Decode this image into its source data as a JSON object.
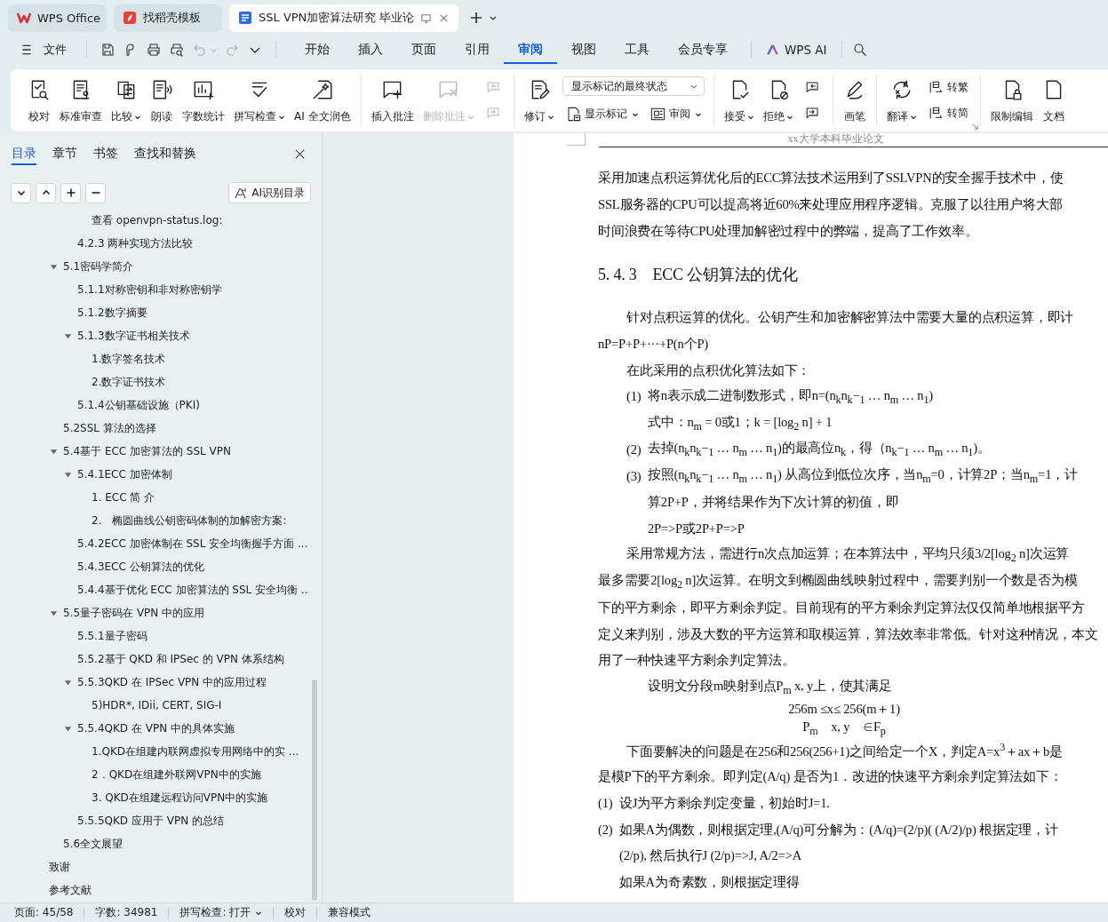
{
  "doc_tabs": [
    {
      "label": "WPS Office",
      "selected": false
    },
    {
      "label": "找稻壳模板",
      "selected": false
    },
    {
      "label": "SSL VPN加密算法研究 毕业论",
      "selected": true
    }
  ],
  "menu": {
    "file": "文件",
    "tabs": [
      {
        "label": "开始",
        "selected": false
      },
      {
        "label": "插入",
        "selected": false
      },
      {
        "label": "页面",
        "selected": false
      },
      {
        "label": "引用",
        "selected": false
      },
      {
        "label": "审阅",
        "selected": true
      },
      {
        "label": "视图",
        "selected": false
      },
      {
        "label": "工具",
        "selected": false
      },
      {
        "label": "会员专享",
        "selected": false
      }
    ],
    "ai": "WPS AI"
  },
  "ribbon": {
    "groups": [
      {
        "items": [
          {
            "kind": "large",
            "label": "校对",
            "menu": false,
            "disabled": false
          },
          {
            "kind": "large",
            "label": "标准审查",
            "menu": false,
            "disabled": false
          },
          {
            "kind": "large",
            "label": "比较",
            "menu": true,
            "disabled": false
          },
          {
            "kind": "large",
            "label": "朗读",
            "menu": false,
            "disabled": false
          },
          {
            "kind": "large",
            "label": "字数统计",
            "menu": false,
            "disabled": false
          },
          {
            "kind": "large",
            "label": "拼写检查",
            "menu": true,
            "disabled": false
          },
          {
            "kind": "large",
            "label": "AI 全文润色",
            "menu": false,
            "disabled": false
          }
        ]
      },
      {
        "items": [
          {
            "kind": "large",
            "label": "插入批注",
            "menu": false,
            "disabled": false
          },
          {
            "kind": "large",
            "label": "删除批注",
            "menu": true,
            "disabled": true
          },
          {
            "kind": "stack",
            "items": [
              {
                "menu": false,
                "disabled": true
              },
              {
                "menu": false,
                "disabled": true
              }
            ]
          }
        ]
      },
      {
        "items": [
          {
            "kind": "large",
            "label": "修订",
            "menu": true,
            "disabled": false
          },
          {
            "kind": "select",
            "value": "显示标记的最终状态",
            "items": [
              {
                "label": "显示标记",
                "menu": true,
                "disabled": false
              },
              {
                "label": "审阅",
                "menu": true,
                "disabled": false
              }
            ]
          }
        ]
      },
      {
        "items": [
          {
            "kind": "large",
            "label": "接受",
            "menu": true,
            "disabled": false
          },
          {
            "kind": "large",
            "label": "拒绝",
            "menu": true,
            "disabled": false
          },
          {
            "kind": "stack",
            "items": [
              {
                "menu": false,
                "disabled": false
              },
              {
                "menu": false,
                "disabled": false
              }
            ]
          }
        ]
      },
      {
        "items": [
          {
            "kind": "large",
            "label": "画笔",
            "menu": false,
            "disabled": false
          }
        ]
      },
      {
        "launcher": true,
        "items": [
          {
            "kind": "large",
            "label": "翻译",
            "menu": true,
            "disabled": false
          },
          {
            "kind": "stack",
            "items": [
              {
                "label": "转繁",
                "menu": false,
                "disabled": false
              },
              {
                "label": "转简",
                "menu": false,
                "disabled": false
              }
            ]
          }
        ]
      },
      {
        "items": [
          {
            "kind": "large",
            "label": "限制编辑",
            "menu": false,
            "disabled": false
          },
          {
            "kind": "large",
            "label": "文档",
            "menu": false,
            "disabled": false
          }
        ]
      }
    ]
  },
  "sidebar": {
    "tabs": [
      {
        "label": "目录",
        "selected": true
      },
      {
        "label": "章节",
        "selected": false
      },
      {
        "label": "书签",
        "selected": false
      },
      {
        "label": "查找和替换",
        "selected": false
      }
    ],
    "ai_button": "AI识别目录",
    "items": [
      {
        "children": [
          {
            "children": [
              {
                "children": [
                  {
                    "label": "查看 openvpn-status.log:"
                  }
                ]
              },
              {
                "label": "4.2.3 两种实现方法比较"
              }
            ]
          }
        ]
      },
      {
        "children": [
          {
            "label": "5.1密码学简介",
            "expanded": true,
            "children": [
              {
                "label": "5.1.1对称密钥和非对称密钥学"
              },
              {
                "label": "5.1.2数字摘要"
              },
              {
                "label": "5.1.3数字证书相关技术",
                "expanded": true,
                "children": [
                  {
                    "label": "1.数字签名技术"
                  },
                  {
                    "label": "2.数字证书技术"
                  }
                ]
              },
              {
                "label": "5.1.4公钥基础设施（PKI)"
              }
            ]
          },
          {
            "label": "5.2SSL 算法的选择"
          },
          {
            "label": "5.4基于 ECC 加密算法的 SSL VPN",
            "expanded": true,
            "children": [
              {
                "label": "5.4.1ECC 加密体制",
                "expanded": true,
                "children": [
                  {
                    "label": "1. ECC 简 介"
                  },
                  {
                    "label": "2.　椭圆曲线公钥密码体制的加解密方案:"
                  }
                ]
              },
              {
                "label": "5.4.2ECC 加密体制在 SSL 安全均衡握手方面 ..."
              },
              {
                "label": "5.4.3ECC 公钥算法的优化"
              },
              {
                "label": "5.4.4基于优化 ECC 加密算法的 SSL 安全均衡 ..."
              }
            ]
          },
          {
            "label": "5.5量子密码在 VPN 中的应用",
            "expanded": true,
            "children": [
              {
                "label": "5.5.1量子密码"
              },
              {
                "label": "5.5.2基于 QKD 和 IPSec 的 VPN 体系结构"
              },
              {
                "label": "5.5.3QKD 在 IPSec VPN 中的应用过程",
                "expanded": true,
                "children": [
                  {
                    "label": "5)HDR*, IDii, CERT, SIG-I"
                  }
                ]
              },
              {
                "label": "5.5.4QKD 在 VPN 中的具体实施",
                "expanded": true,
                "children": [
                  {
                    "label": "1.QKD在组建内联网虚拟专用网络中的实 ..."
                  },
                  {
                    "label": "2．QKD在组建外联网VPN中的实施"
                  },
                  {
                    "label": "3. QKD在组建远程访问VPN中的实施"
                  }
                ]
              },
              {
                "label": "5.5.5QKD 应用于 VPN 的总结"
              }
            ]
          },
          {
            "label": "5.6全文展望"
          }
        ]
      },
      {
        "label": "致谢"
      },
      {
        "label": "参考文献"
      }
    ]
  },
  "document": {
    "header": "xx大学本科毕业论文",
    "blocks": [
      {
        "kind": "line",
        "text": "采用加速点积运算优化后的ECC算法技术运用到了SSLVPN的安全握手技术中，使"
      },
      {
        "kind": "line",
        "text": "SSL服务器的CPU可以提高将近60%来处理应用程序逻辑。克服了以往用户将大部"
      },
      {
        "kind": "line",
        "text": "时间浪费在等待CPU处理加解密过程中的弊端，提高了工作效率。"
      },
      {
        "kind": "heading",
        "text": "5. 4. 3　ECC 公钥算法的优化"
      },
      {
        "kind": "para",
        "text": "针对点积运算的优化。公钥产生和加密解密算法中需要大量的点积运算，即计"
      },
      {
        "kind": "line",
        "text": "nP=P+P+···+P(n个P)"
      },
      {
        "kind": "para",
        "text": "在此采用的点积优化算法如下："
      },
      {
        "kind": "item",
        "marker": "(1)",
        "text": "将n表示成二进制数形式，即n=(n$_{k}$n$_{k}$−$_{1}$ … n$_{m}$ … n$_{1}$)"
      },
      {
        "kind": "cont",
        "text": "式中：n$_{m}$ = 0或1；k = [log$_{2}$ n] + 1"
      },
      {
        "kind": "item",
        "marker": "(2)",
        "text": "去掉(n$_{k}$n$_{k}$−$_{1}$ … n$_{m}$ … n$_{1}$)的最高位n$_{k}$，得（n$_{k}$−$_{1}$ … n$_{m}$ … n$_{1}$)。"
      },
      {
        "kind": "item",
        "marker": "(3)",
        "text": "按照(n$_{k}$n$_{k}$−$_{1}$ … n$_{m}$ … n$_{1}$) 从高位到低位次序，当n$_{m}$=0，计算2P；当n$_{m}$=1，计"
      },
      {
        "kind": "cont",
        "text": "算2P+P，并将结果作为下次计算的初值，即"
      },
      {
        "kind": "cont",
        "text": "2P=>P或2P+P=>P"
      },
      {
        "kind": "para",
        "text": "采用常规方法，需进行n次点加运算；在本算法中，平均只须3/2[log$_{2}$ n]次运算"
      },
      {
        "kind": "line",
        "text": "最多需要2[log$_{2}$ n]次运算。在明文到椭圆曲线映射过程中，需要判别一个数是否为模"
      },
      {
        "kind": "line",
        "text": "下的平方剩余，即平方剩余判定。目前现有的平方剩余判定算法仅仅简单地根据平方"
      },
      {
        "kind": "line",
        "text": "定义来判别，涉及大数的平方运算和取模运算，算法效率非常低。针对这种情况，本文"
      },
      {
        "kind": "line",
        "text": "用了一种快速平方剩余判定算法。"
      },
      {
        "kind": "cont",
        "text": "设明文分段m映射到点P$_{m}$ x, y上，使其满足"
      },
      {
        "kind": "formula",
        "text": "256m ≤x≤ 256(m＋1)"
      },
      {
        "kind": "formula",
        "text": "P$_{m}$　x, y　∈F$_{p}$"
      },
      {
        "kind": "para",
        "text": "下面要解决的问题是在256和256(256+1)之间给定一个X，判定A=x$^{3}$＋ax＋b是"
      },
      {
        "kind": "line",
        "text": "是模P下的平方剩余。即判定(A/q) 是否为1．改进的快速平方剩余判定算法如下："
      },
      {
        "kind": "item_flush",
        "marker": "(1)",
        "text": "设J为平方剩余判定变量，初始时J=1."
      },
      {
        "kind": "item_flush",
        "marker": "(2)",
        "text": "如果A为偶数，则根据定理,(A/q)可分解为：(A/q)=(2/p)( (A/2)/p) 根据定理，计"
      },
      {
        "kind": "cont_flush",
        "text": "(2/p), 然后执行J (2/p)=>J, A/2=>A"
      },
      {
        "kind": "cont_flush",
        "text": "如果A为奇素数，则根据定理得"
      }
    ]
  },
  "status_bar": [
    {
      "label": "页面: 45/58",
      "menu": false
    },
    {
      "label": "字数: 34981",
      "menu": false
    },
    {
      "label": "拼写检查: 打开",
      "menu": true
    },
    {
      "label": "校对",
      "menu": false
    },
    {
      "label": "兼容模式",
      "menu": false
    }
  ]
}
